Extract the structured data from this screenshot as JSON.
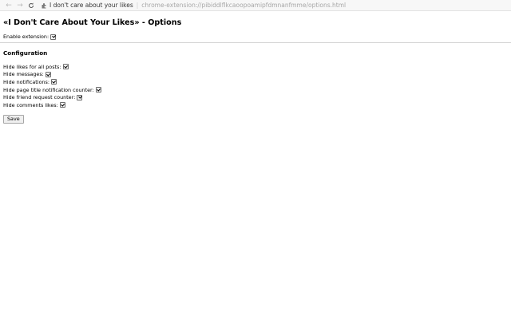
{
  "browser": {
    "tab_title": "I don't care about your likes",
    "url": "chrome-extension://pibiddlflkcaoopoamipfdmnanfmme/options.html",
    "back_icon": "arrow-left-icon",
    "forward_icon": "arrow-right-icon",
    "reload_icon": "reload-icon",
    "extension_icon": "puzzle-icon"
  },
  "page": {
    "title": "«I Don't Care About Your Likes» - Options",
    "enable_label": "Enable extension:",
    "enable_checked": true,
    "config_heading": "Configuration",
    "options": [
      {
        "label": "Hide likes for all posts:",
        "checked": true
      },
      {
        "label": "Hide messages:",
        "checked": true
      },
      {
        "label": "Hide notifications:",
        "checked": true
      },
      {
        "label": "Hide page title notification counter:",
        "checked": true
      },
      {
        "label": "Hide friend request counter:",
        "checked": true
      },
      {
        "label": "Hide comments likes:",
        "checked": true
      }
    ],
    "save_label": "Save"
  }
}
